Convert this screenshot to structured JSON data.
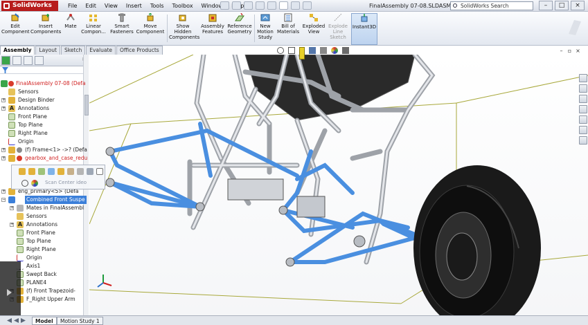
{
  "app": {
    "name": "SolidWorks",
    "document_title": "FinalAssembly 07-08.SLDASM",
    "search_placeholder": "SolidWorks Search"
  },
  "menu": [
    "File",
    "Edit",
    "View",
    "Insert",
    "Tools",
    "Toolbox",
    "Window",
    "Help"
  ],
  "commands": [
    {
      "label": "Edit\nComponent"
    },
    {
      "label": "Insert\nComponents"
    },
    {
      "label": "Mate"
    },
    {
      "label": "Linear\nCompon..."
    },
    {
      "label": "Smart\nFasteners"
    },
    {
      "label": "Move\nComponent"
    },
    {
      "label": "Show\nHidden\nComponents"
    },
    {
      "label": "Assembly\nFeatures"
    },
    {
      "label": "Reference\nGeometry"
    },
    {
      "label": "New\nMotion\nStudy"
    },
    {
      "label": "Bill of\nMaterials"
    },
    {
      "label": "Exploded\nView"
    },
    {
      "label": "Explode\nLine\nSketch"
    },
    {
      "label": "Instant3D"
    }
  ],
  "tabs": [
    "Assembly",
    "Layout",
    "Sketch",
    "Evaluate",
    "Office Products"
  ],
  "tree": {
    "root": "FinalAssembly 07-08  (Defa",
    "items": [
      {
        "label": "Sensors"
      },
      {
        "label": "Design Binder"
      },
      {
        "label": "Annotations"
      },
      {
        "label": "Front Plane"
      },
      {
        "label": "Top Plane"
      },
      {
        "label": "Right Plane"
      },
      {
        "label": "Origin"
      },
      {
        "label": "(f) Frame<1> ->? (Defa"
      },
      {
        "label": "gearbox_and_case_redu"
      },
      {
        "label": "eng_primary<5> (Defa"
      },
      {
        "label": "Combined Front Suspe"
      },
      {
        "label": "Mates in FinalAssembl"
      },
      {
        "label": "Sensors"
      },
      {
        "label": "Annotations"
      },
      {
        "label": "Front Plane"
      },
      {
        "label": "Top Plane"
      },
      {
        "label": "Right Plane"
      },
      {
        "label": "Origin"
      },
      {
        "label": "Axis1"
      },
      {
        "label": "Swept Back"
      },
      {
        "label": "PLANE4"
      },
      {
        "label": "(f) Front Trapezoid-"
      },
      {
        "label": "F_Right Upper Arm"
      }
    ]
  },
  "context_toolbar": {
    "label": "Scan Center ideo"
  },
  "bottom_tabs": [
    "Model",
    "Motion Study 1"
  ],
  "colors": {
    "suspension": "#4a8fe0",
    "frame_tube": "#d6d8dc",
    "bounding_box": "#a8a83a",
    "selection": "#3b7fd9",
    "logo": "#b71c1c"
  }
}
